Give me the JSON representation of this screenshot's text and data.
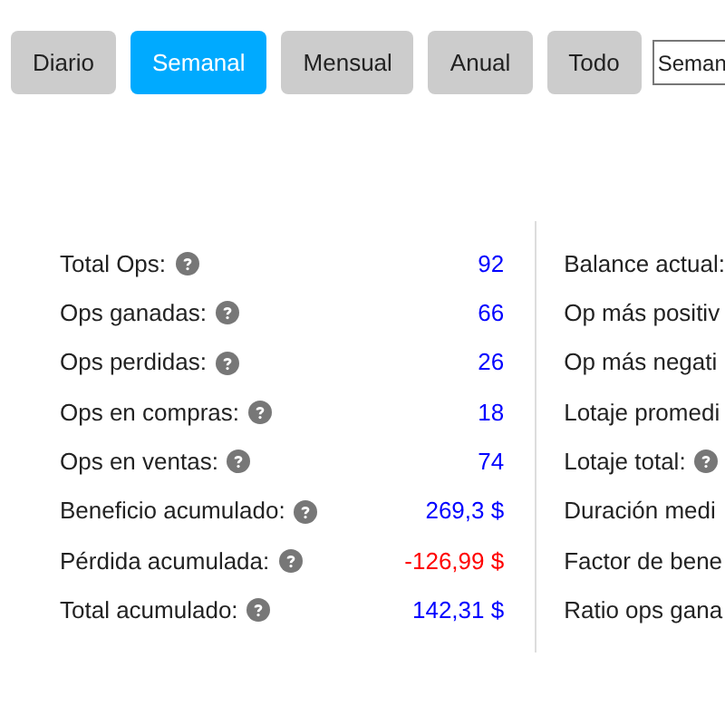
{
  "period_tabs": [
    {
      "label": "Diario",
      "selected": false
    },
    {
      "label": "Semanal",
      "selected": true
    },
    {
      "label": "Mensual",
      "selected": false
    },
    {
      "label": "Anual",
      "selected": false
    },
    {
      "label": "Todo",
      "selected": false
    }
  ],
  "period_select": {
    "value": "Seman"
  },
  "stats_left": [
    {
      "label": "Total Ops:",
      "value": "92",
      "color": "#0000ff"
    },
    {
      "label": "Ops ganadas:",
      "value": "66",
      "color": "#0000ff"
    },
    {
      "label": "Ops perdidas:",
      "value": "26",
      "color": "#0000ff"
    },
    {
      "label": "Ops en compras:",
      "value": "18",
      "color": "#0000ff"
    },
    {
      "label": "Ops en ventas:",
      "value": "74",
      "color": "#0000ff"
    },
    {
      "label": "Beneficio acumulado:",
      "value": "269,3 $",
      "color": "#0000ff"
    },
    {
      "label": "Pérdida acumulada:",
      "value": "-126,99 $",
      "color": "#ff0000"
    },
    {
      "label": "Total acumulado:",
      "value": "142,31 $",
      "color": "#0000ff"
    }
  ],
  "stats_right": [
    {
      "label": "Balance actual:",
      "help": false
    },
    {
      "label": "Op más positiv",
      "help": false
    },
    {
      "label": "Op más negati",
      "help": false
    },
    {
      "label": "Lotaje promedi",
      "help": false
    },
    {
      "label": "Lotaje total:",
      "help": true
    },
    {
      "label": "Duración medi",
      "help": false
    },
    {
      "label": "Factor de bene",
      "help": false
    },
    {
      "label": "Ratio ops gana",
      "help": false
    }
  ]
}
